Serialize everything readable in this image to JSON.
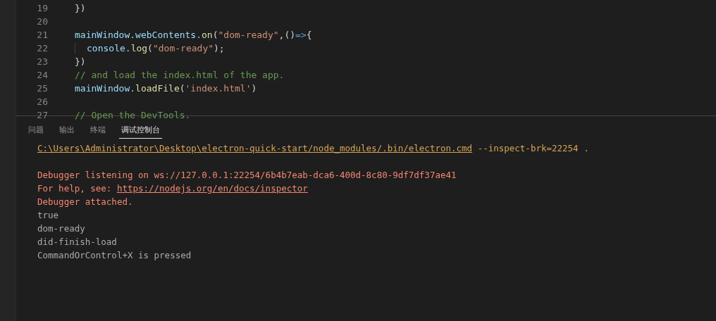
{
  "editor": {
    "lines": [
      {
        "number": "19",
        "tokens": [
          {
            "kind": "punct",
            "text": "})"
          }
        ]
      },
      {
        "number": "20"
      },
      {
        "number": "21",
        "tokens": [
          {
            "kind": "var",
            "text": "mainWindow."
          },
          {
            "kind": "var",
            "text": "webContents."
          },
          {
            "kind": "func",
            "text": "on"
          },
          {
            "kind": "punct",
            "text": "("
          },
          {
            "kind": "string",
            "text": "\"dom-ready\""
          },
          {
            "kind": "punct",
            "text": ",()"
          },
          {
            "kind": "keyword",
            "text": "=>"
          },
          {
            "kind": "punct",
            "text": "{"
          }
        ]
      },
      {
        "number": "22",
        "indented": true,
        "tokens": [
          {
            "kind": "var",
            "text": "console."
          },
          {
            "kind": "func",
            "text": "log"
          },
          {
            "kind": "punct",
            "text": "("
          },
          {
            "kind": "string",
            "text": "\"dom-ready\""
          },
          {
            "kind": "punct",
            "text": ");"
          }
        ]
      },
      {
        "number": "23",
        "tokens": [
          {
            "kind": "punct",
            "text": "})"
          }
        ]
      },
      {
        "number": "24",
        "tokens": [
          {
            "kind": "comment",
            "text": "// and load the index.html of the app."
          }
        ]
      },
      {
        "number": "25",
        "tokens": [
          {
            "kind": "var",
            "text": "mainWindow."
          },
          {
            "kind": "func",
            "text": "loadFile"
          },
          {
            "kind": "punct",
            "text": "("
          },
          {
            "kind": "string",
            "text": "'index.html'"
          },
          {
            "kind": "punct",
            "text": ")"
          }
        ]
      },
      {
        "number": "26"
      },
      {
        "number": "27",
        "tokens": [
          {
            "kind": "comment",
            "text": "// Open the DevTools."
          }
        ]
      }
    ]
  },
  "panel": {
    "tabs": [
      {
        "label": "问题",
        "selected": false
      },
      {
        "label": "输出",
        "selected": false
      },
      {
        "label": "终端",
        "selected": false
      },
      {
        "label": "调试控制台",
        "selected": true
      }
    ],
    "lines": [
      {
        "kind": "command",
        "segments": [
          {
            "kind": "link",
            "text": "C:\\Users\\Administrator\\Desktop\\electron-quick-start/node_modules/.bin/electron.cmd"
          },
          {
            "kind": "plain",
            "text": " --inspect-brk=22254 ."
          }
        ]
      },
      {
        "kind": "blank"
      },
      {
        "kind": "error",
        "segments": [
          {
            "kind": "plain",
            "text": "Debugger listening on ws://127.0.0.1:22254/6b4b7eab-dca6-400d-8c80-9df7df37ae41"
          }
        ]
      },
      {
        "kind": "error",
        "segments": [
          {
            "kind": "plain",
            "text": "For help, see: "
          },
          {
            "kind": "link",
            "text": "https://nodejs.org/en/docs/inspector"
          }
        ]
      },
      {
        "kind": "error",
        "segments": [
          {
            "kind": "plain",
            "text": "Debugger attached."
          }
        ]
      },
      {
        "kind": "log",
        "segments": [
          {
            "kind": "plain",
            "text": "true"
          }
        ]
      },
      {
        "kind": "log",
        "segments": [
          {
            "kind": "plain",
            "text": "dom-ready"
          }
        ]
      },
      {
        "kind": "log",
        "segments": [
          {
            "kind": "plain",
            "text": "did-finish-load"
          }
        ]
      },
      {
        "kind": "log",
        "segments": [
          {
            "kind": "plain",
            "text": "CommandOrControl+X is pressed"
          }
        ]
      }
    ]
  }
}
